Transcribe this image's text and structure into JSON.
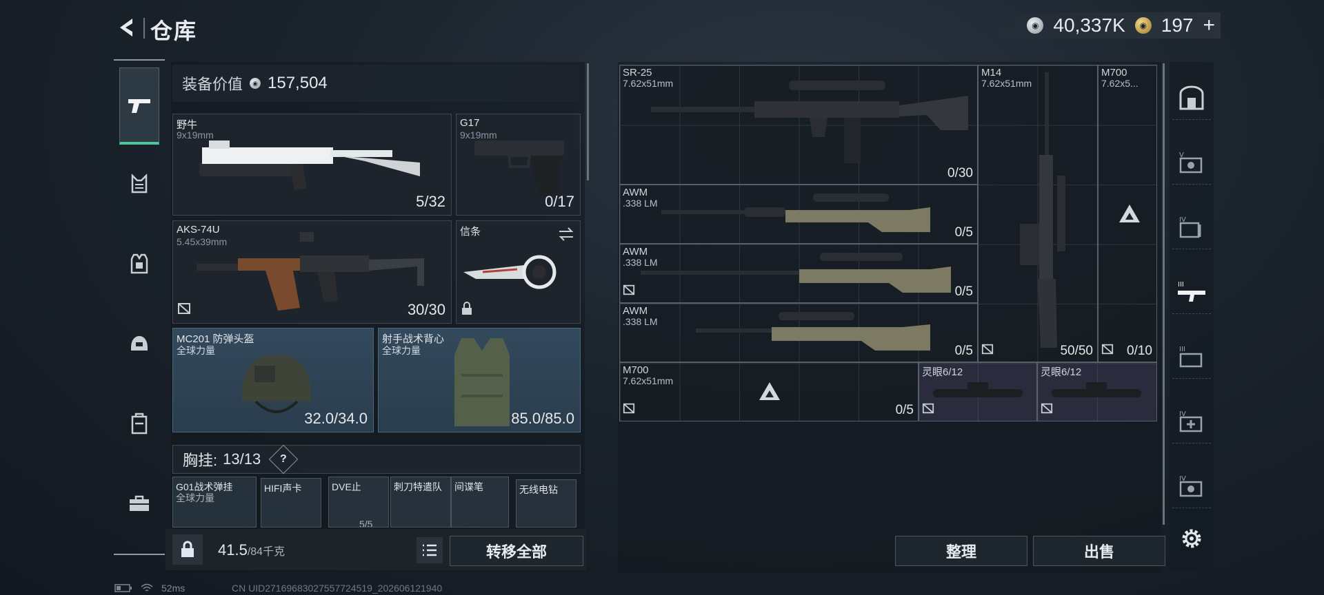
{
  "header": {
    "title": "仓库",
    "currency1": "40,337K",
    "currency2": "197",
    "plus": "+"
  },
  "loadout": {
    "value_label": "装备价值",
    "value": "157,504",
    "slots": {
      "primary1": {
        "name": "野牛",
        "cal": "9x19mm",
        "ammo": "5/32"
      },
      "pistol": {
        "name": "G17",
        "cal": "9x19mm",
        "ammo": "0/17"
      },
      "primary2": {
        "name": "AKS-74U",
        "cal": "5.45x39mm",
        "ammo": "30/30"
      },
      "melee": {
        "name": "信条"
      },
      "helmet": {
        "name": "MC201 防弹头盔",
        "sub": "全球力量",
        "durability": "32.0/34.0"
      },
      "armor": {
        "name": "射手战术背心",
        "sub": "全球力量",
        "durability": "85.0/85.0"
      }
    },
    "chest_label": "胸挂:",
    "chest_count": "13/13",
    "help": "?",
    "chest_items": [
      {
        "name": "G01战术弹挂",
        "sub": "全球力量"
      },
      {
        "name": "HIFI声卡"
      },
      {
        "name": "DVE止",
        "sub": "5/5"
      },
      {
        "name": "刺刀特遣队"
      },
      {
        "name": "间谍笔"
      },
      {
        "name": "无线电钻"
      }
    ],
    "weight_value": "41.5",
    "weight_max": "/84千克",
    "transfer_all": "转移全部"
  },
  "storage": {
    "items": [
      {
        "name": "SR-25",
        "cal": "7.62x51mm",
        "ammo": "0/30"
      },
      {
        "name": "M14",
        "cal": "7.62x51mm",
        "ammo": "50/50"
      },
      {
        "name": "M700",
        "cal": "7.62x5...",
        "ammo": "0/10"
      },
      {
        "name": "AWM",
        "cal": ".338 LM",
        "ammo": "0/5"
      },
      {
        "name": "AWM",
        "cal": ".338 LM",
        "ammo": "0/5"
      },
      {
        "name": "AWM",
        "cal": ".338 LM",
        "ammo": "0/5"
      },
      {
        "name": "M700",
        "cal": "7.62x51mm",
        "ammo": "0/5"
      },
      {
        "name": "灵眼6/12"
      },
      {
        "name": "灵眼6/12"
      }
    ],
    "sort": "整理",
    "sell": "出售"
  },
  "status": {
    "ping": "52ms",
    "uid": "CN UID2716968302755772451​9_202606121940"
  }
}
